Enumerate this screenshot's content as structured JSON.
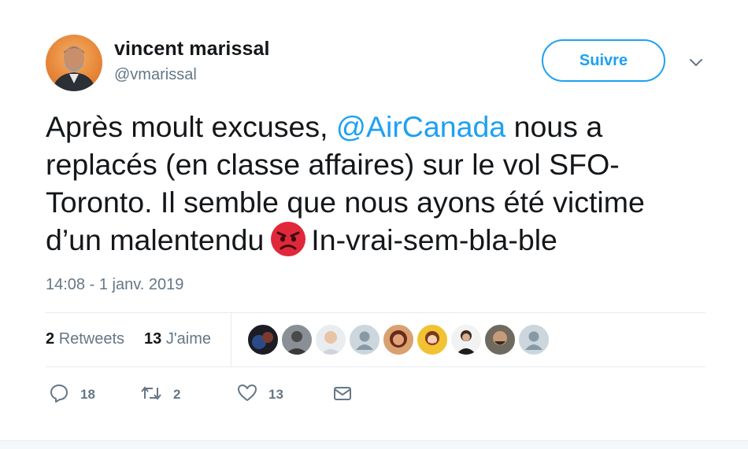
{
  "user": {
    "display_name": "vincent marissal",
    "handle": "@vmarissal",
    "avatar_icon": "profile-photo"
  },
  "follow_button": {
    "label": "Suivre"
  },
  "tweet": {
    "line1_a": "Après moult excuses, ",
    "line1_mention": "@AirCanada",
    "line1_b": " nous a",
    "line2": "replacés (en classe affaires) sur le vol SFO-",
    "line3": "Toronto. Il semble que nous ayons été victime",
    "line4_a": "d’un malentendu",
    "line4_emoji": "angry-face-emoji",
    "line4_b": "In-vrai-sem-bla-ble",
    "timestamp": "14:08 - 1 janv. 2019"
  },
  "stats": {
    "retweets_count": "2",
    "retweets_label": "Retweets",
    "likes_count": "13",
    "likes_label": "J'aime",
    "liker_avatars": [
      "liker-1",
      "liker-2",
      "liker-3",
      "liker-4",
      "liker-5",
      "liker-6",
      "liker-7",
      "liker-8",
      "liker-9"
    ]
  },
  "actions": {
    "reply_count": "18",
    "retweet_count": "2",
    "like_count": "13"
  },
  "colors": {
    "accent": "#1da1f2",
    "text": "#14171a",
    "muted": "#657786",
    "angry_emoji": "#e0283a"
  }
}
